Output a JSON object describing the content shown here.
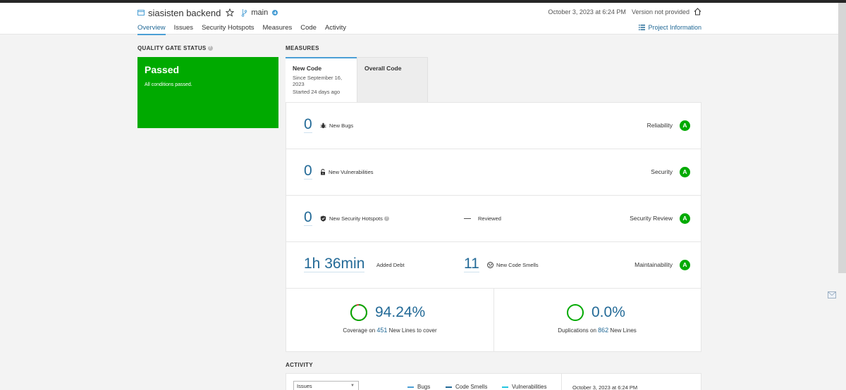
{
  "project": {
    "name": "siasisten backend",
    "branch": "main"
  },
  "header": {
    "datetime": "October 3, 2023 at 6:24 PM",
    "version": "Version not provided",
    "project_info": "Project Information"
  },
  "nav": {
    "tabs": [
      "Overview",
      "Issues",
      "Security Hotspots",
      "Measures",
      "Code",
      "Activity"
    ]
  },
  "quality_gate": {
    "title": "QUALITY GATE STATUS",
    "status": "Passed",
    "message": "All conditions passed."
  },
  "measures": {
    "title": "MEASURES",
    "tab_new": {
      "label": "New Code",
      "since": "Since September 16, 2023",
      "started": "Started 24 days ago"
    },
    "tab_overall": {
      "label": "Overall Code"
    },
    "rows": {
      "bugs": {
        "value": "0",
        "label": "New Bugs",
        "rating_label": "Reliability",
        "rating": "A"
      },
      "vulnerabilities": {
        "value": "0",
        "label": "New Vulnerabilities",
        "rating_label": "Security",
        "rating": "A"
      },
      "hotspots": {
        "value": "0",
        "label": "New Security Hotspots",
        "reviewed": "Reviewed",
        "rating_label": "Security Review",
        "rating": "A"
      },
      "maintainability": {
        "debt": "1h 36min",
        "debt_label": "Added Debt",
        "smells": "11",
        "smells_label": "New Code Smells",
        "rating_label": "Maintainability",
        "rating": "A"
      }
    },
    "coverage": {
      "percent": "94.24%",
      "value": 94.24,
      "prefix": "Coverage on",
      "lines": "451",
      "suffix": "New Lines to cover"
    },
    "duplications": {
      "percent": "0.0%",
      "value": 0.0,
      "prefix": "Duplications on",
      "lines": "862",
      "suffix": "New Lines"
    }
  },
  "activity": {
    "title": "ACTIVITY",
    "select_value": "Issues",
    "legend": {
      "bugs": "Bugs",
      "smells": "Code Smells",
      "vulns": "Vulnerabilities"
    },
    "date": "October 3, 2023 at 6:24 PM"
  },
  "colors": {
    "passed": "#00aa00",
    "link": "#236a97",
    "accent": "#4b9fd5"
  }
}
